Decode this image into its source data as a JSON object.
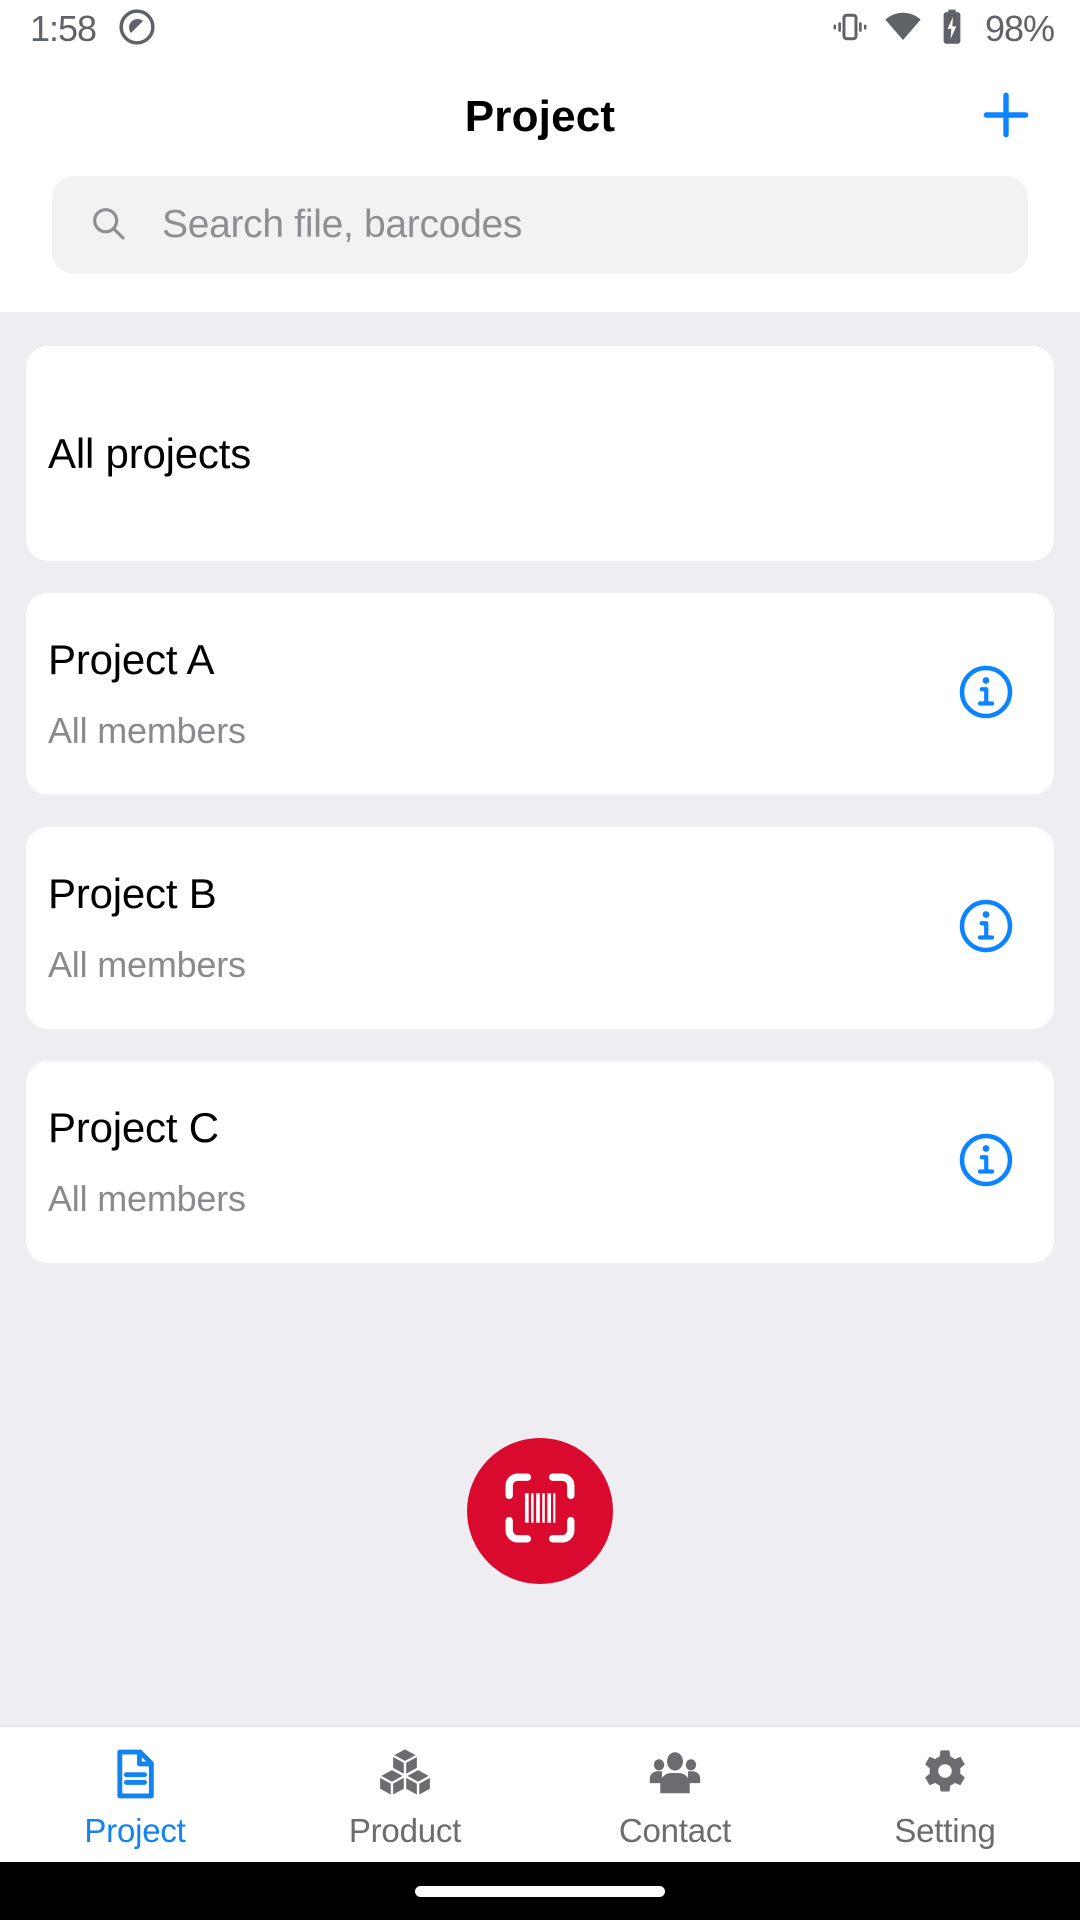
{
  "status_bar": {
    "time": "1:58",
    "battery_percent": "98%",
    "icons": {
      "left_app": "do-not-disturb-icon",
      "vibrate": "vibrate-icon",
      "wifi": "wifi-icon",
      "battery": "battery-charging-icon"
    }
  },
  "app_bar": {
    "title": "Project",
    "add_icon": "plus-icon"
  },
  "search": {
    "placeholder": "Search file, barcodes",
    "icon": "search-icon",
    "value": ""
  },
  "projects": [
    {
      "title": "All projects",
      "subtitle": "",
      "has_info": false
    },
    {
      "title": "Project A",
      "subtitle": "All members",
      "has_info": true,
      "info_icon": "info-circle-icon"
    },
    {
      "title": "Project B",
      "subtitle": "All members",
      "has_info": true,
      "info_icon": "info-circle-icon"
    },
    {
      "title": "Project C",
      "subtitle": "All members",
      "has_info": true,
      "info_icon": "info-circle-icon"
    }
  ],
  "scan_button": {
    "icon": "barcode-scan-icon",
    "color": "#da0a2e"
  },
  "bottom_nav": {
    "active_index": 0,
    "items": [
      {
        "label": "Project",
        "icon": "document-icon"
      },
      {
        "label": "Product",
        "icon": "boxes-icon"
      },
      {
        "label": "Contact",
        "icon": "people-icon"
      },
      {
        "label": "Setting",
        "icon": "gear-icon"
      }
    ]
  },
  "colors": {
    "accent_blue": "#1383f0",
    "scan_red": "#da0a2e",
    "background_gray": "#eeeef2",
    "muted_text": "#8a8a8e"
  }
}
